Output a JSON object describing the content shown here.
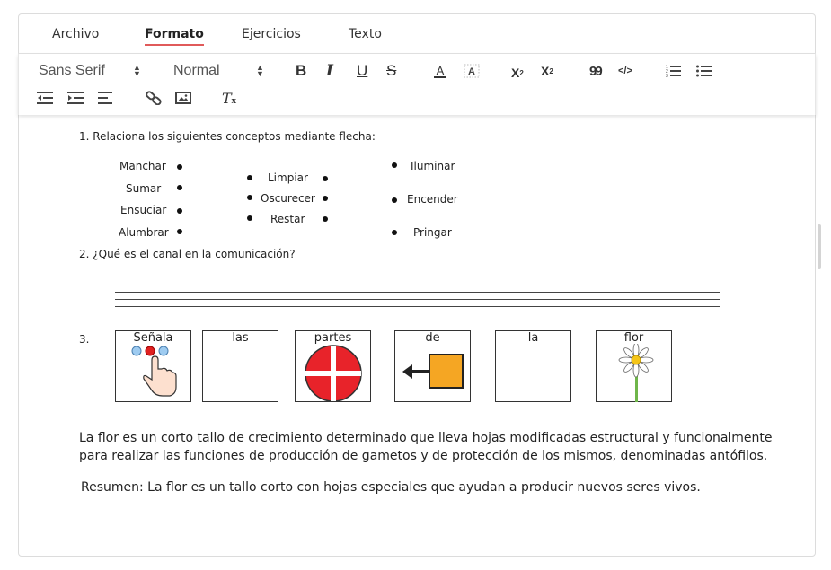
{
  "tabs": [
    {
      "label": "Archivo"
    },
    {
      "label": "Formato"
    },
    {
      "label": "Ejercicios"
    },
    {
      "label": "Texto"
    }
  ],
  "active_tab": "Formato",
  "toolbar": {
    "font_select": "Sans Serif",
    "size_select": "Normal",
    "bold": "B",
    "italic": "I",
    "underline": "U",
    "strike": "S",
    "font_color": "A",
    "subscript_base": "X",
    "subscript_mark": "2",
    "superscript_base": "X",
    "superscript_mark": "2",
    "quote": "99",
    "code": "</>",
    "clear_format": "T"
  },
  "accent_color": "#e05a5a",
  "exercise1": {
    "title": "1. Relaciona los siguientes conceptos mediante flecha:",
    "col1": [
      "Manchar",
      "Sumar",
      "Ensuciar",
      "Alumbrar"
    ],
    "col2": [
      "Limpiar",
      "Oscurecer",
      "Restar"
    ],
    "col3": [
      "Iluminar",
      "Encender",
      "Pringar"
    ]
  },
  "exercise2": {
    "title": "2. ¿Qué es el canal en la comunicación?"
  },
  "exercise3": {
    "number": "3.",
    "cards": [
      "Señala",
      "las",
      "partes",
      "de",
      "la",
      "flor"
    ]
  },
  "paragraph": "La flor es un corto tallo de crecimiento determinado que lleva hojas modificadas estructural y funcionalmente para realizar las funciones de producción de gametos y de protección de los mismos, denominadas antófilos.",
  "summary": "Resumen: La flor es un tallo corto con hojas especiales que ayudan a producir nuevos seres vivos."
}
